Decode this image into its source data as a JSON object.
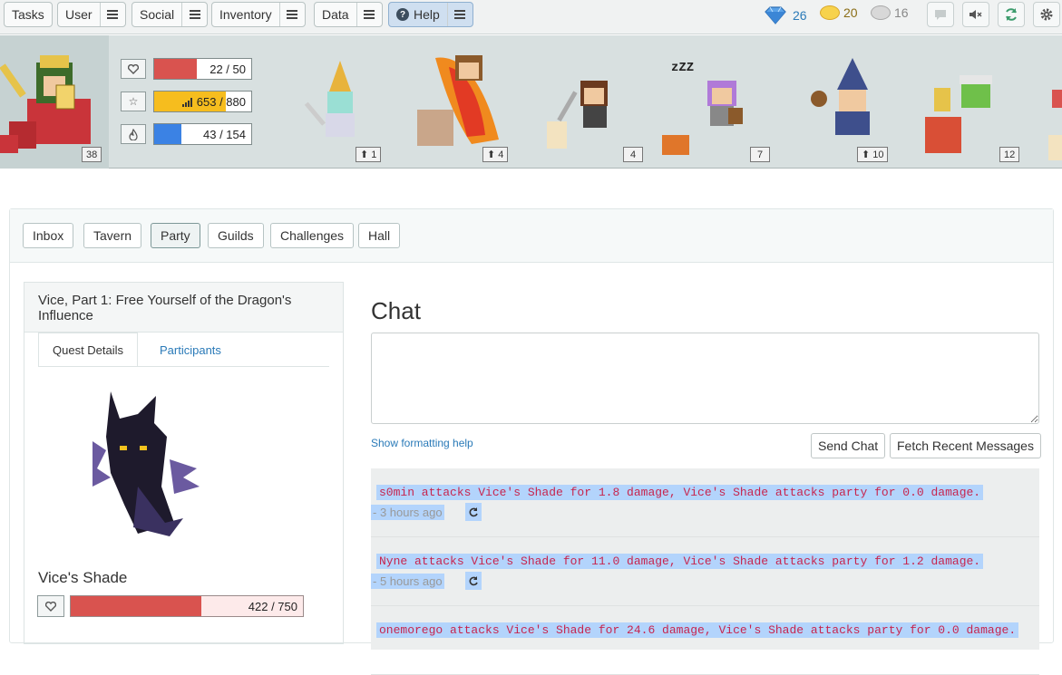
{
  "nav": {
    "tasks": "Tasks",
    "user": "User",
    "social": "Social",
    "inventory": "Inventory",
    "data": "Data",
    "help": "Help"
  },
  "currency": {
    "gems": "26",
    "gold": "20",
    "silver": "16"
  },
  "header": {
    "level": "38",
    "health": {
      "value": "22 / 50",
      "fraction": 0.44,
      "color": "#d9534f"
    },
    "experience": {
      "value": "653 / 880",
      "fraction": 0.74,
      "color": "#f6bd1e"
    },
    "mana": {
      "value": "43 / 154",
      "fraction": 0.28,
      "color": "#3b82e4"
    },
    "party": [
      {
        "badge": "1",
        "arrow": true
      },
      {
        "badge": "4",
        "arrow": true
      },
      {
        "badge": "4",
        "arrow": false
      },
      {
        "badge": "7",
        "arrow": false
      },
      {
        "badge": "10",
        "arrow": true
      },
      {
        "badge": "12",
        "arrow": false
      }
    ],
    "sleep_text": "zZZ"
  },
  "tabs": [
    "Inbox",
    "Tavern",
    "Party",
    "Guilds",
    "Challenges",
    "Hall"
  ],
  "quest": {
    "title": "Vice, Part 1: Free Yourself of the Dragon's Influence",
    "tab_details": "Quest Details",
    "tab_participants": "Participants",
    "boss_name": "Vice's Shade",
    "boss_hp": "422 / 750",
    "boss_hp_fraction": 0.5627
  },
  "chat": {
    "title": "Chat",
    "format_help": "Show formatting help",
    "send": "Send Chat",
    "fetch": "Fetch Recent Messages",
    "messages": [
      {
        "text": "s0min attacks Vice's Shade for 1.8 damage, Vice's Shade attacks party for 0.0 damage.",
        "time": "- 3 hours ago"
      },
      {
        "text": "Nyne attacks Vice's Shade for 11.0 damage, Vice's Shade attacks party for 1.2 damage.",
        "time": "- 5 hours ago"
      },
      {
        "text": "onemorego attacks Vice's Shade for 24.6 damage, Vice's Shade attacks party for 0.0 damage.",
        "time": ""
      }
    ]
  }
}
